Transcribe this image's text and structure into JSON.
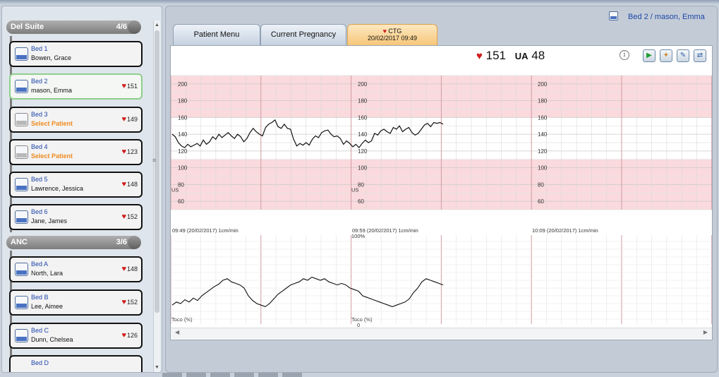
{
  "groups": [
    {
      "name": "Del Suite",
      "count": "4/6"
    },
    {
      "name": "ANC",
      "count": "3/6"
    }
  ],
  "beds": [
    {
      "bed": "Bed 1",
      "patient": "Bowen, Grace",
      "hr": ""
    },
    {
      "bed": "Bed 2",
      "patient": "mason, Emma",
      "hr": "151"
    },
    {
      "bed": "Bed 3",
      "patient": "Select Patient",
      "hr": "149"
    },
    {
      "bed": "Bed 4",
      "patient": "Select Patient",
      "hr": "123"
    },
    {
      "bed": "Bed 5",
      "patient": "Lawrence, Jessica",
      "hr": "148"
    },
    {
      "bed": "Bed 6",
      "patient": "Jane, James",
      "hr": "152"
    },
    {
      "bed": "Bed A",
      "patient": "North, Lara",
      "hr": "148"
    },
    {
      "bed": "Bed B",
      "patient": "Lee, Aimee",
      "hr": "152"
    },
    {
      "bed": "Bed C",
      "patient": "Dunn, Chelsea",
      "hr": "126"
    },
    {
      "bed": "Bed D",
      "patient": "",
      "hr": ""
    }
  ],
  "header": {
    "bed_label": "Bed 2",
    "separator": " / ",
    "patient": "mason, Emma"
  },
  "tabs": {
    "patient_menu": "Patient Menu",
    "current_pregnancy": "Current Pregnancy",
    "ctg_title": "CTG",
    "ctg_time": "20/02/2017 09:49"
  },
  "live": {
    "fhr": "151",
    "ua_label": "UA",
    "ua": "48"
  },
  "icons": {
    "info": "info-icon",
    "play": "play-icon",
    "mark": "event-mark-icon",
    "edit": "edit-icon",
    "swap": "swap-view-icon",
    "heart": "heart-icon"
  },
  "colors": {
    "alarm_zone": "#fadadd",
    "grid_major": "#e8a8ae",
    "grid_minor": "#d8d8d8",
    "trace": "#111111",
    "accent_tab": "#f7c77a"
  },
  "chart_data": [
    {
      "type": "line",
      "title": "",
      "ylabel": "US",
      "y_ticks": [
        200,
        180,
        160,
        140,
        120,
        100,
        80,
        60
      ],
      "ylim": [
        50,
        210
      ],
      "normal_band": [
        110,
        160
      ],
      "x_labels": [
        "09:49 (20/02/2017) 1cm/min",
        "09:59 (20/02/2017) 1cm/min",
        "10:09 (20/02/2017) 1cm/min"
      ],
      "series": [
        {
          "values": [
            140,
            137,
            130,
            126,
            124,
            128,
            125,
            127,
            129,
            126,
            133,
            128,
            131,
            137,
            134,
            140,
            136,
            139,
            142,
            138,
            135,
            140,
            137,
            131,
            135,
            142,
            147,
            143,
            140,
            138,
            148,
            152,
            154,
            157,
            149,
            147,
            152,
            147,
            146,
            134,
            126,
            129,
            127,
            130,
            127,
            134,
            138,
            136,
            142,
            144,
            145,
            140,
            137,
            138,
            135,
            128,
            132,
            129,
            125,
            128,
            124,
            129,
            133,
            130,
            132,
            141,
            139,
            144,
            146,
            143,
            141,
            148,
            146,
            150,
            143,
            146,
            148,
            142,
            139,
            141,
            146,
            151,
            153,
            149,
            154,
            153,
            154,
            152
          ]
        }
      ]
    },
    {
      "type": "line",
      "ylabel": "Toco (%)",
      "y_ticks": [
        "100%",
        "0"
      ],
      "ylim": [
        0,
        100
      ],
      "series": [
        {
          "values": [
            18,
            22,
            20,
            25,
            22,
            27,
            24,
            30,
            34,
            38,
            42,
            45,
            50,
            52,
            48,
            46,
            44,
            40,
            30,
            24,
            20,
            18,
            16,
            20,
            26,
            32,
            36,
            40,
            44,
            46,
            48,
            52,
            50,
            54,
            52,
            50,
            52,
            48,
            46,
            44,
            46,
            44,
            40,
            38,
            36,
            30,
            28,
            26,
            24,
            22,
            20,
            18,
            16,
            18,
            20,
            22,
            26,
            34,
            40,
            48,
            52,
            50,
            48,
            46,
            44
          ]
        }
      ]
    }
  ]
}
